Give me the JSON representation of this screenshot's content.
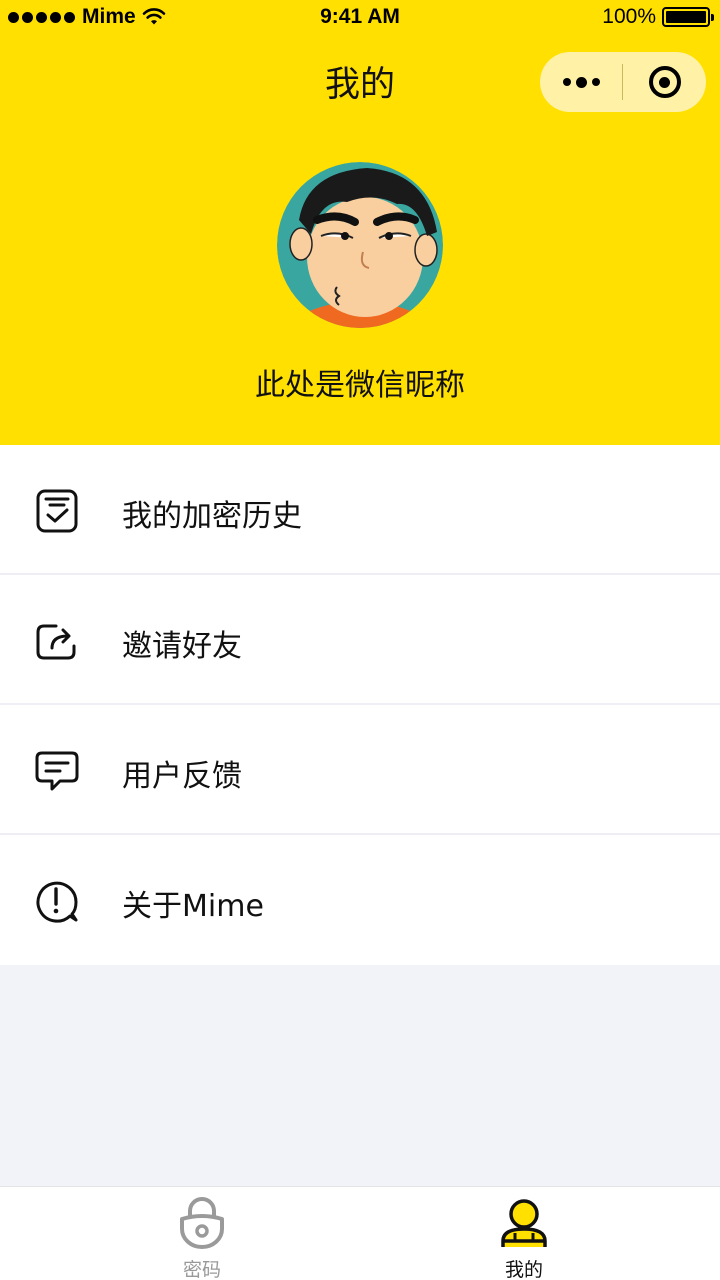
{
  "status_bar": {
    "carrier": "Mime",
    "time": "9:41 AM",
    "battery": "100%"
  },
  "nav": {
    "title": "我的"
  },
  "profile": {
    "nickname": "此处是微信昵称"
  },
  "menu": {
    "items": [
      {
        "label": "我的加密历史",
        "icon": "history-checklist-icon"
      },
      {
        "label": "邀请好友",
        "icon": "share-icon"
      },
      {
        "label": "用户反馈",
        "icon": "feedback-message-icon"
      },
      {
        "label": "关于Mime",
        "icon": "info-exclamation-icon"
      }
    ]
  },
  "tabbar": {
    "tabs": [
      {
        "label": "密码",
        "icon": "lock-icon",
        "active": false
      },
      {
        "label": "我的",
        "icon": "user-icon",
        "active": true
      }
    ]
  },
  "colors": {
    "brand_yellow": "#ffe000",
    "capsule_bg": "#fff1a6",
    "page_bg": "#f2f3f8",
    "inactive_tab": "#999999"
  }
}
